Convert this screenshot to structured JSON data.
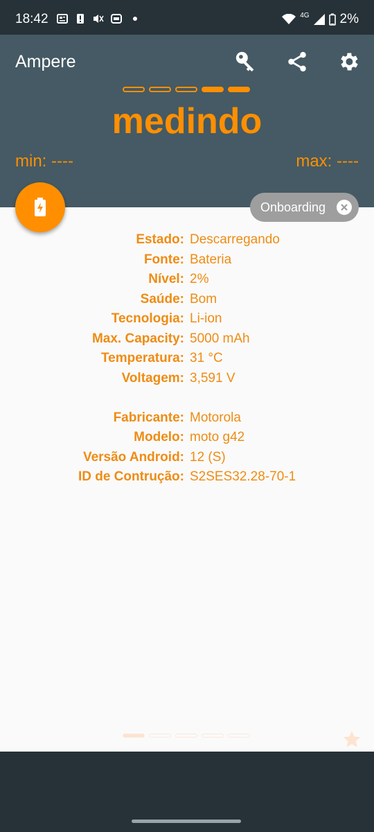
{
  "status_bar": {
    "time": "18:42",
    "network": "4G",
    "battery": "2%"
  },
  "app": {
    "title": "Ampere",
    "icons": [
      "key-icon",
      "share-icon",
      "gear-icon"
    ]
  },
  "meter": {
    "value": "medindo",
    "min_label": "min: ----",
    "max_label": "max: ----",
    "top_pager_active": [
      3,
      4
    ],
    "bottom_pager_active": 0
  },
  "chip": {
    "label": "Onboarding"
  },
  "battery_info": [
    {
      "label": "Estado:",
      "value": "Descarregando"
    },
    {
      "label": "Fonte:",
      "value": "Bateria"
    },
    {
      "label": "Nível:",
      "value": "2%"
    },
    {
      "label": "Saúde:",
      "value": "Bom"
    },
    {
      "label": "Tecnologia:",
      "value": "Li-ion"
    },
    {
      "label": "Max. Capacity:",
      "value": "5000 mAh"
    },
    {
      "label": "Temperatura:",
      "value": "31 °C"
    },
    {
      "label": "Voltagem:",
      "value": "3,591 V"
    }
  ],
  "device_info": [
    {
      "label": "Fabricante:",
      "value": "Motorola"
    },
    {
      "label": "Modelo:",
      "value": "moto g42"
    },
    {
      "label": "Versão Android:",
      "value": "12 (S)"
    },
    {
      "label": "ID de Contrução:",
      "value": "S2SES32.28-70-1"
    }
  ],
  "colors": {
    "accent": "#ff8f00",
    "header": "#455a64",
    "system_bar": "#263238",
    "chip": "#9e9e9e"
  }
}
